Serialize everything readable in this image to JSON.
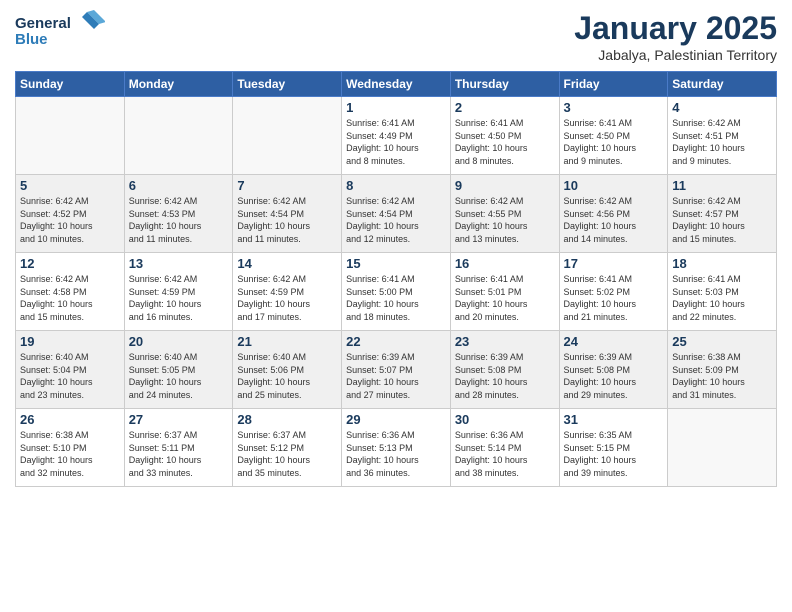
{
  "header": {
    "logo_line1": "General",
    "logo_line2": "Blue",
    "month": "January 2025",
    "location": "Jabalya, Palestinian Territory"
  },
  "weekdays": [
    "Sunday",
    "Monday",
    "Tuesday",
    "Wednesday",
    "Thursday",
    "Friday",
    "Saturday"
  ],
  "weeks": [
    [
      {
        "day": "",
        "info": ""
      },
      {
        "day": "",
        "info": ""
      },
      {
        "day": "",
        "info": ""
      },
      {
        "day": "1",
        "info": "Sunrise: 6:41 AM\nSunset: 4:49 PM\nDaylight: 10 hours\nand 8 minutes."
      },
      {
        "day": "2",
        "info": "Sunrise: 6:41 AM\nSunset: 4:50 PM\nDaylight: 10 hours\nand 8 minutes."
      },
      {
        "day": "3",
        "info": "Sunrise: 6:41 AM\nSunset: 4:50 PM\nDaylight: 10 hours\nand 9 minutes."
      },
      {
        "day": "4",
        "info": "Sunrise: 6:42 AM\nSunset: 4:51 PM\nDaylight: 10 hours\nand 9 minutes."
      }
    ],
    [
      {
        "day": "5",
        "info": "Sunrise: 6:42 AM\nSunset: 4:52 PM\nDaylight: 10 hours\nand 10 minutes."
      },
      {
        "day": "6",
        "info": "Sunrise: 6:42 AM\nSunset: 4:53 PM\nDaylight: 10 hours\nand 11 minutes."
      },
      {
        "day": "7",
        "info": "Sunrise: 6:42 AM\nSunset: 4:54 PM\nDaylight: 10 hours\nand 11 minutes."
      },
      {
        "day": "8",
        "info": "Sunrise: 6:42 AM\nSunset: 4:54 PM\nDaylight: 10 hours\nand 12 minutes."
      },
      {
        "day": "9",
        "info": "Sunrise: 6:42 AM\nSunset: 4:55 PM\nDaylight: 10 hours\nand 13 minutes."
      },
      {
        "day": "10",
        "info": "Sunrise: 6:42 AM\nSunset: 4:56 PM\nDaylight: 10 hours\nand 14 minutes."
      },
      {
        "day": "11",
        "info": "Sunrise: 6:42 AM\nSunset: 4:57 PM\nDaylight: 10 hours\nand 15 minutes."
      }
    ],
    [
      {
        "day": "12",
        "info": "Sunrise: 6:42 AM\nSunset: 4:58 PM\nDaylight: 10 hours\nand 15 minutes."
      },
      {
        "day": "13",
        "info": "Sunrise: 6:42 AM\nSunset: 4:59 PM\nDaylight: 10 hours\nand 16 minutes."
      },
      {
        "day": "14",
        "info": "Sunrise: 6:42 AM\nSunset: 4:59 PM\nDaylight: 10 hours\nand 17 minutes."
      },
      {
        "day": "15",
        "info": "Sunrise: 6:41 AM\nSunset: 5:00 PM\nDaylight: 10 hours\nand 18 minutes."
      },
      {
        "day": "16",
        "info": "Sunrise: 6:41 AM\nSunset: 5:01 PM\nDaylight: 10 hours\nand 20 minutes."
      },
      {
        "day": "17",
        "info": "Sunrise: 6:41 AM\nSunset: 5:02 PM\nDaylight: 10 hours\nand 21 minutes."
      },
      {
        "day": "18",
        "info": "Sunrise: 6:41 AM\nSunset: 5:03 PM\nDaylight: 10 hours\nand 22 minutes."
      }
    ],
    [
      {
        "day": "19",
        "info": "Sunrise: 6:40 AM\nSunset: 5:04 PM\nDaylight: 10 hours\nand 23 minutes."
      },
      {
        "day": "20",
        "info": "Sunrise: 6:40 AM\nSunset: 5:05 PM\nDaylight: 10 hours\nand 24 minutes."
      },
      {
        "day": "21",
        "info": "Sunrise: 6:40 AM\nSunset: 5:06 PM\nDaylight: 10 hours\nand 25 minutes."
      },
      {
        "day": "22",
        "info": "Sunrise: 6:39 AM\nSunset: 5:07 PM\nDaylight: 10 hours\nand 27 minutes."
      },
      {
        "day": "23",
        "info": "Sunrise: 6:39 AM\nSunset: 5:08 PM\nDaylight: 10 hours\nand 28 minutes."
      },
      {
        "day": "24",
        "info": "Sunrise: 6:39 AM\nSunset: 5:08 PM\nDaylight: 10 hours\nand 29 minutes."
      },
      {
        "day": "25",
        "info": "Sunrise: 6:38 AM\nSunset: 5:09 PM\nDaylight: 10 hours\nand 31 minutes."
      }
    ],
    [
      {
        "day": "26",
        "info": "Sunrise: 6:38 AM\nSunset: 5:10 PM\nDaylight: 10 hours\nand 32 minutes."
      },
      {
        "day": "27",
        "info": "Sunrise: 6:37 AM\nSunset: 5:11 PM\nDaylight: 10 hours\nand 33 minutes."
      },
      {
        "day": "28",
        "info": "Sunrise: 6:37 AM\nSunset: 5:12 PM\nDaylight: 10 hours\nand 35 minutes."
      },
      {
        "day": "29",
        "info": "Sunrise: 6:36 AM\nSunset: 5:13 PM\nDaylight: 10 hours\nand 36 minutes."
      },
      {
        "day": "30",
        "info": "Sunrise: 6:36 AM\nSunset: 5:14 PM\nDaylight: 10 hours\nand 38 minutes."
      },
      {
        "day": "31",
        "info": "Sunrise: 6:35 AM\nSunset: 5:15 PM\nDaylight: 10 hours\nand 39 minutes."
      },
      {
        "day": "",
        "info": ""
      }
    ]
  ]
}
